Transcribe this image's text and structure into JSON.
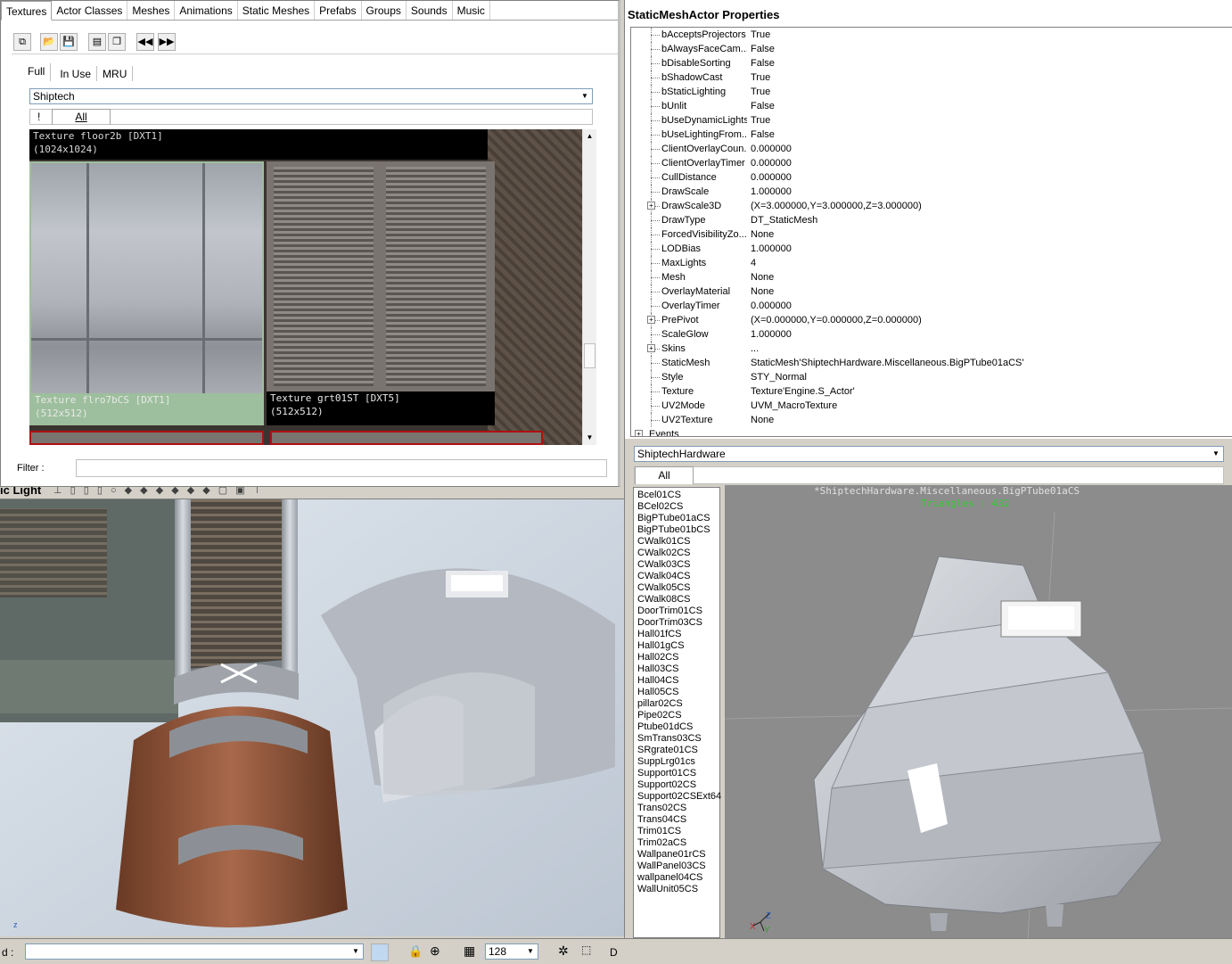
{
  "browser": {
    "tabs": [
      "Textures",
      "Actor Classes",
      "Meshes",
      "Animations",
      "Static Meshes",
      "Prefabs",
      "Groups",
      "Sounds",
      "Music"
    ],
    "active_tab": 0,
    "subtabs": [
      "Full",
      "In Use",
      "MRU"
    ],
    "package_combo": "Shiptech",
    "group_tabs": [
      "!",
      "All"
    ],
    "textures": [
      {
        "label": "Texture floor2b [DXT1]",
        "size": "(1024x1024)"
      },
      {
        "label": "Texture flro7bCS [DXT1]",
        "size": "(512x512)"
      },
      {
        "label": "Texture grt01ST [DXT5]",
        "size": "(512x512)"
      }
    ],
    "filter_label": "Filter :",
    "filter_value": ""
  },
  "viewport": {
    "title_partial": "ic Light",
    "axis": "z",
    "bottom_label": "d :",
    "grid_value": "128",
    "right_label": "D"
  },
  "properties": {
    "title": "StaticMeshActor Properties",
    "rows": [
      {
        "name": "bAcceptsProjectors",
        "value": "True"
      },
      {
        "name": "bAlwaysFaceCam...",
        "value": "False"
      },
      {
        "name": "bDisableSorting",
        "value": "False"
      },
      {
        "name": "bShadowCast",
        "value": "True"
      },
      {
        "name": "bStaticLighting",
        "value": "True"
      },
      {
        "name": "bUnlit",
        "value": "False"
      },
      {
        "name": "bUseDynamicLights",
        "value": "True"
      },
      {
        "name": "bUseLightingFrom...",
        "value": "False"
      },
      {
        "name": "ClientOverlayCoun...",
        "value": "0.000000"
      },
      {
        "name": "ClientOverlayTimer",
        "value": "0.000000"
      },
      {
        "name": "CullDistance",
        "value": "0.000000"
      },
      {
        "name": "DrawScale",
        "value": "1.000000"
      },
      {
        "name": "DrawScale3D",
        "value": "(X=3.000000,Y=3.000000,Z=3.000000)",
        "expandable": true
      },
      {
        "name": "DrawType",
        "value": "DT_StaticMesh"
      },
      {
        "name": "ForcedVisibilityZo...",
        "value": "None"
      },
      {
        "name": "LODBias",
        "value": "1.000000"
      },
      {
        "name": "MaxLights",
        "value": "4"
      },
      {
        "name": "Mesh",
        "value": "None"
      },
      {
        "name": "OverlayMaterial",
        "value": "None"
      },
      {
        "name": "OverlayTimer",
        "value": "0.000000"
      },
      {
        "name": "PrePivot",
        "value": "(X=0.000000,Y=0.000000,Z=0.000000)",
        "expandable": true
      },
      {
        "name": "ScaleGlow",
        "value": "1.000000"
      },
      {
        "name": "Skins",
        "value": "...",
        "expandable": true
      },
      {
        "name": "StaticMesh",
        "value": "StaticMesh'ShiptechHardware.Miscellaneous.BigPTube01aCS'"
      },
      {
        "name": "Style",
        "value": "STY_Normal"
      },
      {
        "name": "Texture",
        "value": "Texture'Engine.S_Actor'"
      },
      {
        "name": "UV2Mode",
        "value": "UVM_MacroTexture"
      },
      {
        "name": "UV2Texture",
        "value": "None"
      }
    ],
    "next_category": "Events"
  },
  "static_mesh_browser": {
    "package_combo": "ShiptechHardware",
    "group_tab": "All",
    "meshes": [
      "Bcel01CS",
      "BCel02CS",
      "BigPTube01aCS",
      "BigPTube01bCS",
      "CWalk01CS",
      "CWalk02CS",
      "CWalk03CS",
      "CWalk04CS",
      "CWalk05CS",
      "CWalk08CS",
      "DoorTrim01CS",
      "DoorTrim03CS",
      "Hall01fCS",
      "Hall01gCS",
      "Hall02CS",
      "Hall03CS",
      "Hall04CS",
      "Hall05CS",
      "pillar02CS",
      "Pipe02CS",
      "Ptube01dCS",
      "SmTrans03CS",
      "SRgrate01CS",
      "SuppLrg01cs",
      "Support01CS",
      "Support02CS",
      "Support02CSExt64",
      "Trans02CS",
      "Trans04CS",
      "Trim01CS",
      "Trim02aCS",
      "Wallpane01rCS",
      "WallPanel03CS",
      "wallpanel04CS",
      "WallUnit05CS"
    ],
    "preview_title": "*ShiptechHardware.Miscellaneous.BigPTube01aCS",
    "preview_triangles": "Triangles : 432",
    "axis_labels": {
      "x": "X",
      "y": "Y",
      "z": "Z"
    }
  },
  "colors": {
    "window_bg": "#ffffff",
    "chrome": "#d4d0c8",
    "selection_green": "#9dbf9d",
    "selection_red": "#b01010",
    "preview_bg": "#8c8c8c",
    "triangles_green": "#30d030"
  }
}
